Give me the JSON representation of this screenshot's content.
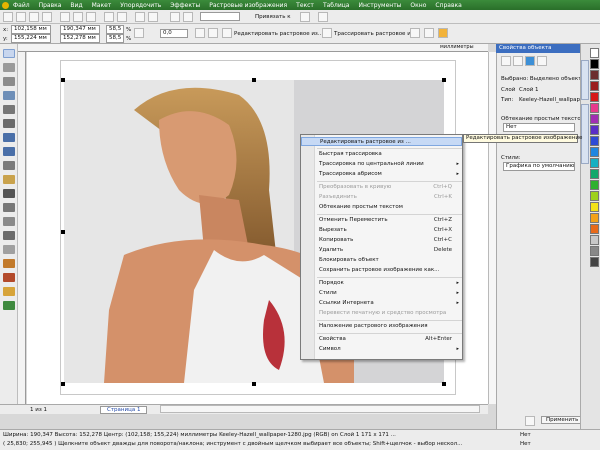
{
  "menu": {
    "items": [
      "Файл",
      "Правка",
      "Вид",
      "Макет",
      "Упорядочить",
      "Эффекты",
      "Растровые изображения",
      "Текст",
      "Таблица",
      "Инструменты",
      "Окно",
      "Справка"
    ]
  },
  "toolbar": {
    "x_label": "x:",
    "x_value": "102,158 мм",
    "y_label": "y:",
    "y_value": "155,224 мм",
    "w_value": "190,347 мм",
    "h_value": "152,278 мм",
    "scale_x": "58,5",
    "scale_y": "58,5",
    "percent": "%",
    "angle": "0,0",
    "zoom_label": "Привязать к",
    "edit_bitmap_button": "Редактировать растровое из...",
    "trace_bitmap_button": "Трассировать растровое из..."
  },
  "rulers": {
    "unit": "миллиметры"
  },
  "pages": {
    "label": "1 из 1",
    "tab": "Страница 1"
  },
  "docker": {
    "title": "Свойства объекта",
    "selected_label": "Выбрано: Выделено объектов",
    "layer_label": "Слой",
    "layer_value": "Слой 1",
    "type_label": "Тип:",
    "type_value": "Keeley-Hazell_wallpaper",
    "wrap_label": "Обтекание простым текстом:",
    "wrap_value": "Нет",
    "styles_label": "Стили:",
    "styles_value": "Графика по умолчанию",
    "apply_button": "Применить",
    "vertical_tab_1": "Свойства объекта",
    "vertical_tab_2": "Трассировка растровых изображений"
  },
  "context_menu": {
    "items": [
      {
        "label": "Редактировать растровое из ...",
        "shortcut": "",
        "arrow": false,
        "disabled": false,
        "highlighted": true
      },
      {
        "label": "Быстрая трассировка",
        "shortcut": "",
        "arrow": false,
        "disabled": false,
        "highlighted": false
      },
      {
        "label": "Трассировка по центральной линии",
        "shortcut": "",
        "arrow": true,
        "disabled": false,
        "highlighted": false
      },
      {
        "label": "Трассировка абрисом",
        "shortcut": "",
        "arrow": true,
        "disabled": false,
        "highlighted": false
      },
      {
        "label": "Преобразовать в кривую",
        "shortcut": "Ctrl+Q",
        "arrow": false,
        "disabled": true,
        "highlighted": false
      },
      {
        "label": "Разъединить",
        "shortcut": "Ctrl+K",
        "arrow": false,
        "disabled": true,
        "highlighted": false
      },
      {
        "label": "Обтекание простым текстом",
        "shortcut": "",
        "arrow": false,
        "disabled": false,
        "highlighted": false
      },
      {
        "label": "Отменить Переместить",
        "shortcut": "Ctrl+Z",
        "arrow": false,
        "disabled": false,
        "highlighted": false
      },
      {
        "label": "Вырезать",
        "shortcut": "Ctrl+X",
        "arrow": false,
        "disabled": false,
        "highlighted": false
      },
      {
        "label": "Копировать",
        "shortcut": "Ctrl+C",
        "arrow": false,
        "disabled": false,
        "highlighted": false
      },
      {
        "label": "Удалить",
        "shortcut": "Delete",
        "arrow": false,
        "disabled": false,
        "highlighted": false
      },
      {
        "label": "Блокировать объект",
        "shortcut": "",
        "arrow": false,
        "disabled": false,
        "highlighted": false
      },
      {
        "label": "Сохранить растровое изображение как...",
        "shortcut": "",
        "arrow": false,
        "disabled": false,
        "highlighted": false
      },
      {
        "label": "Порядок",
        "shortcut": "",
        "arrow": true,
        "disabled": false,
        "highlighted": false
      },
      {
        "label": "Стили",
        "shortcut": "",
        "arrow": true,
        "disabled": false,
        "highlighted": false
      },
      {
        "label": "Ссылки Интернета",
        "shortcut": "",
        "arrow": true,
        "disabled": false,
        "highlighted": false
      },
      {
        "label": "Перевести печатную и средство просмотра",
        "shortcut": "",
        "arrow": false,
        "disabled": true,
        "highlighted": false
      },
      {
        "label": "Наложение растрового изображения",
        "shortcut": "",
        "arrow": false,
        "disabled": false,
        "highlighted": false
      },
      {
        "label": "Свойства",
        "shortcut": "Alt+Enter",
        "arrow": false,
        "disabled": false,
        "highlighted": false
      },
      {
        "label": "Символ",
        "shortcut": "",
        "arrow": true,
        "disabled": false,
        "highlighted": false
      }
    ],
    "tooltip": "Редактировать растровое изображение"
  },
  "status": {
    "line1": "Ширина: 190,347 Высота: 152,278 Центр: (102,158; 155,224) миллиметры    Keeley-Hazell_wallpaper-1280.jpg (RGB) on Слой 1 171 x 171 ...",
    "line2": "( 25,830; 255,945 )    Щелкните объект дважды для поворота/наклона; инструмент с двойным щелчком выбирает все объекты; Shift+щелчок - выбор нескол...",
    "fill_value": "Нет",
    "outline_value": "Нет"
  },
  "colors": {
    "menubar": "#2f7a2f",
    "highlight": "#c6d9f5",
    "docker_title": "#3c6ec0",
    "palette": [
      "#ffffff",
      "#000000",
      "#6b2e2e",
      "#9b1b1b",
      "#d61a1a",
      "#e83a8c",
      "#a12eb3",
      "#5a2ec7",
      "#2e4bd6",
      "#1e86e0",
      "#16b0c2",
      "#12a86a",
      "#2fb02f",
      "#9ed11c",
      "#f2e21a",
      "#f2a21a",
      "#e86a1a",
      "#c8c8c8",
      "#888888",
      "#444444"
    ]
  }
}
